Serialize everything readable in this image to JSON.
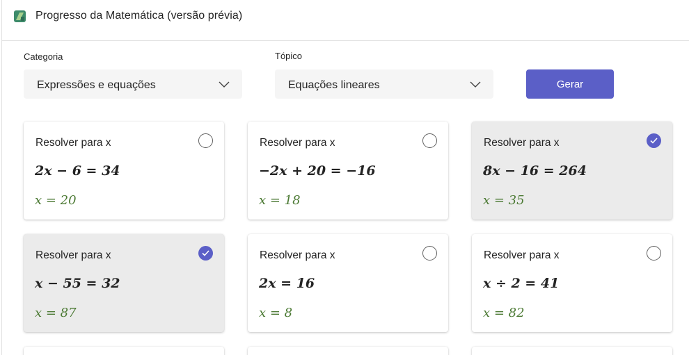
{
  "app": {
    "title": "Progresso da Matemática (versão prévia)",
    "icon": "math-progress-app-icon"
  },
  "filters": {
    "category_label": "Categoria",
    "category_value": "Expressões e equações",
    "topic_label": "Tópico",
    "topic_value": "Equações lineares",
    "generate_label": "Gerar"
  },
  "colors": {
    "accent": "#5b5fc7",
    "answer": "#4c7a34",
    "selected_card_bg": "#ebebeb"
  },
  "problems": [
    {
      "prompt": "Resolver para x",
      "equation": "2x − 6 = 34",
      "answer": "x = 20",
      "selected": false
    },
    {
      "prompt": "Resolver para x",
      "equation": "−2x + 20 = −16",
      "answer": "x = 18",
      "selected": false
    },
    {
      "prompt": "Resolver para x",
      "equation": "8x − 16 = 264",
      "answer": "x = 35",
      "selected": true
    },
    {
      "prompt": "Resolver para x",
      "equation": "x − 55 = 32",
      "answer": "x = 87",
      "selected": true
    },
    {
      "prompt": "Resolver para x",
      "equation": "2x = 16",
      "answer": "x = 8",
      "selected": false
    },
    {
      "prompt": "Resolver para x",
      "equation": "x ÷ 2 = 41",
      "answer": "x = 82",
      "selected": false
    }
  ]
}
